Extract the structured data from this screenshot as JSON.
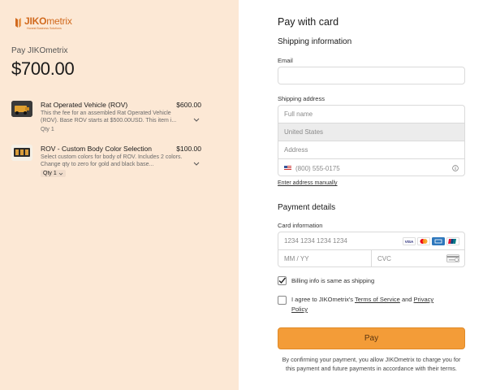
{
  "merchant": {
    "logo_bold": "JIKO",
    "logo_light": "metrix",
    "logo_tagline": "Honest Business Solutions",
    "pay_label": "Pay JIKOmetrix",
    "total": "$700.00",
    "accent_color": "#d1691d",
    "left_bg_color": "#fce8d5"
  },
  "items": [
    {
      "title": "Rat Operated Vehicle (ROV)",
      "price": "$600.00",
      "description": "This the fee for an assembled Rat Operated Vehicle (ROV). Base ROV starts at $500.00USD. This item i...",
      "qty": "Qty 1",
      "icon": "chevron-down-icon"
    },
    {
      "title": "ROV - Custom Body Color Selection",
      "price": "$100.00",
      "description": "Select custom colors for body of ROV. Includes 2 colors. Change qty to zero for gold and black base...",
      "qty": "Qty 1",
      "icon": "chevron-down-icon"
    }
  ],
  "form": {
    "title": "Pay with card",
    "shipping_heading": "Shipping information",
    "email_label": "Email",
    "email_value": "",
    "address_label": "Shipping address",
    "full_name_placeholder": "Full name",
    "country_value": "United States",
    "address_placeholder": "Address",
    "phone_placeholder": "(800) 555-0175",
    "enter_manually_link": "Enter address manually",
    "payment_heading": "Payment details",
    "card_label": "Card information",
    "card_number_placeholder": "1234 1234 1234 1234",
    "expiry_placeholder": "MM / YY",
    "cvc_placeholder": "CVC",
    "card_brands": [
      "VISA",
      "mastercard",
      "AMEX",
      "UnionPay"
    ],
    "billing_same_label": "Billing info is same as shipping",
    "billing_same_checked": true,
    "agree_prefix": "I agree to JIKOmetrix's ",
    "terms_link": "Terms of Service",
    "agree_and": " and ",
    "privacy_link_1": "Privacy",
    "privacy_link_2": "Policy",
    "agree_checked": false,
    "pay_button": "Pay",
    "pay_button_color": "#f39c38",
    "terms_text": "By confirming your payment, you allow JIKOmetrix to charge you for this payment and future payments in accordance with their terms."
  }
}
